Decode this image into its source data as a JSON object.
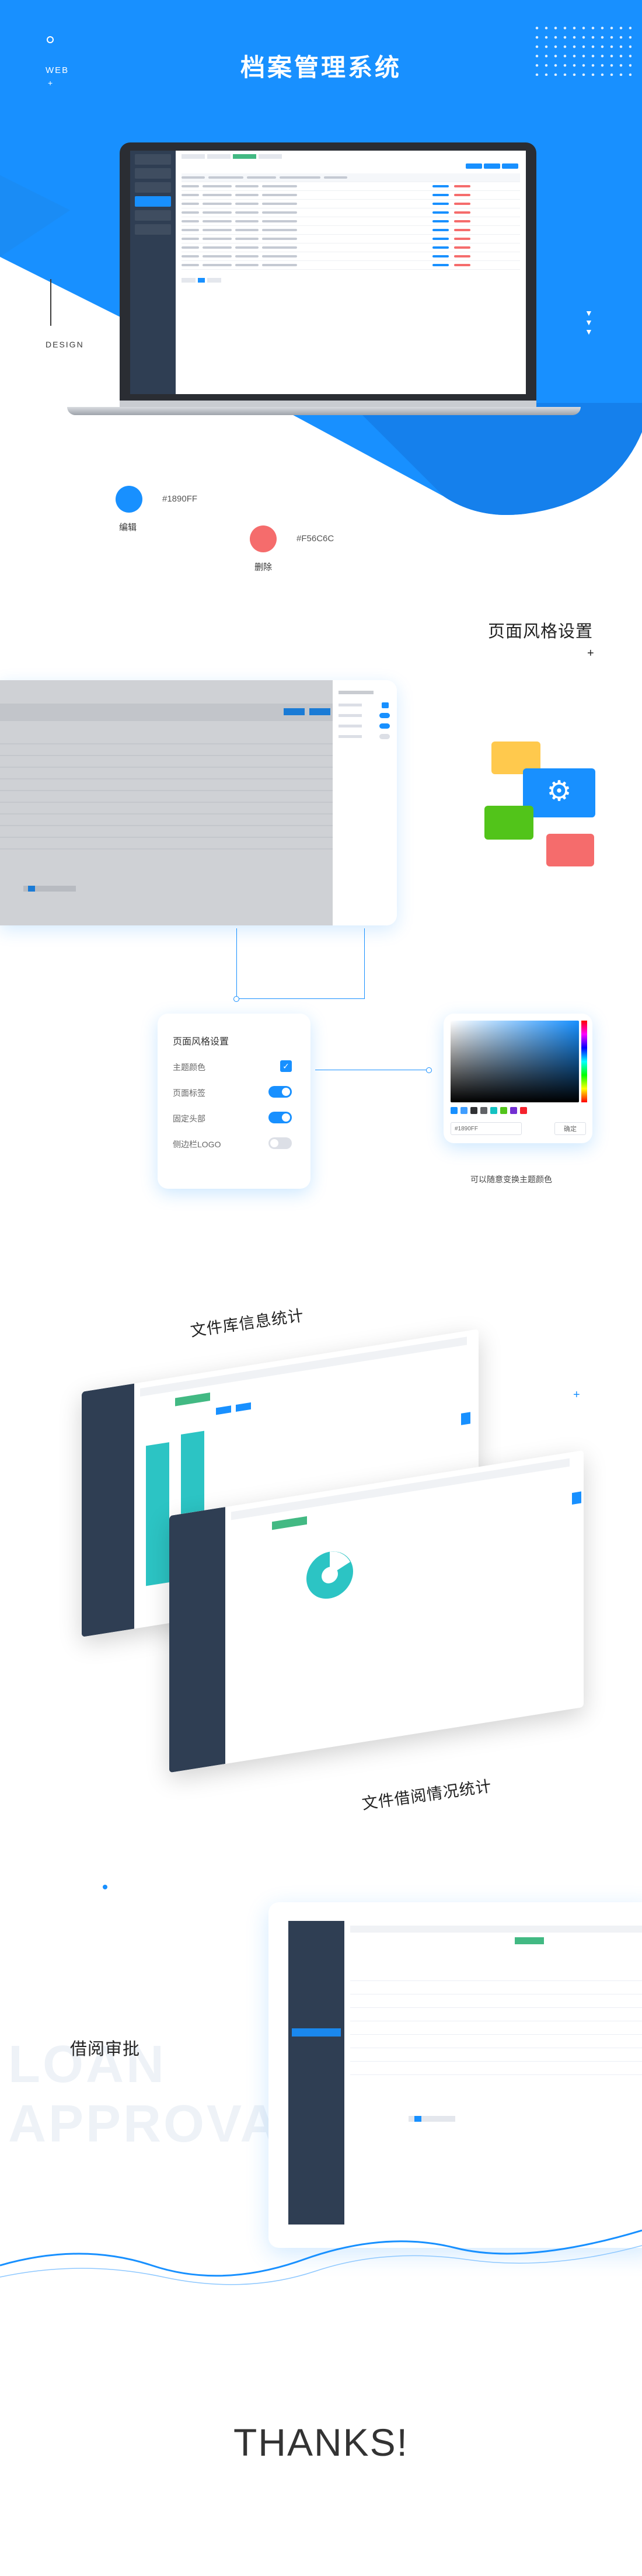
{
  "hero": {
    "title": "档案管理系统",
    "web_label": "WEB",
    "design_label": "DESIGN"
  },
  "colors": {
    "primary": "#1890FF",
    "danger": "#F56C6C",
    "primary_hex_label": "#1890FF",
    "danger_hex_label": "#F56C6C",
    "primary_caption": "编辑",
    "danger_caption": "删除"
  },
  "page_style": {
    "title": "页面风格设置",
    "plus": "+",
    "settings_card": {
      "title": "页面风格设置",
      "rows": [
        {
          "label": "主题颜色",
          "control": "check"
        },
        {
          "label": "页面标签",
          "control": "toggle-on"
        },
        {
          "label": "固定头部",
          "control": "toggle-on"
        },
        {
          "label": "侧边栏LOGO",
          "control": "toggle-off"
        }
      ]
    },
    "picker": {
      "input_value": "#1890FF",
      "ok_label": "确定",
      "swatches": [
        "#1890ff",
        "#409eff",
        "#303133",
        "#606266",
        "#13c2c2",
        "#52c41a",
        "#722ed1",
        "#f5222d"
      ]
    },
    "picker_caption": "可以随意变换主题颜色",
    "tiles": [
      "#ffc94d",
      "#1890ff",
      "#52c41a",
      "#f56c6c"
    ]
  },
  "stats": {
    "library_title": "文件库信息统计",
    "borrow_title": "文件借阅情况统计"
  },
  "approval": {
    "title": "借阅审批",
    "ghost_line1": "LOAN",
    "ghost_line2": "APPROVAL"
  },
  "footer": {
    "thanks": "THANKS!"
  }
}
